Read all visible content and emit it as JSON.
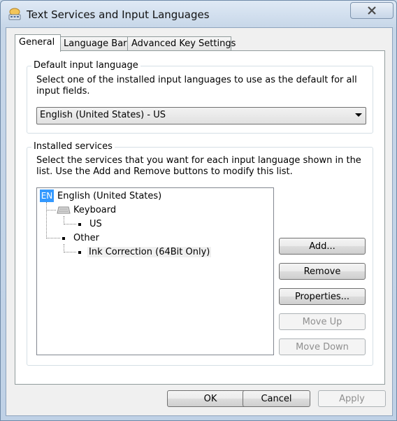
{
  "window": {
    "title": "Text Services and Input Languages",
    "close_icon": "close-icon"
  },
  "tabs": [
    {
      "label": "General",
      "active": true
    },
    {
      "label": "Language Bar",
      "active": false
    },
    {
      "label": "Advanced Key Settings",
      "active": false
    }
  ],
  "default_language": {
    "group_label": "Default input language",
    "description": "Select one of the installed input languages to use as the default for all input fields.",
    "selected": "English (United States) - US"
  },
  "installed_services": {
    "group_label": "Installed services",
    "description": "Select the services that you want for each input language shown in the list. Use the Add and Remove buttons to modify this list.",
    "tree": {
      "language_badge": "EN",
      "language": "English (United States)",
      "keyboard_label": "Keyboard",
      "keyboard_item": "US",
      "other_label": "Other",
      "other_item": "Ink Correction (64Bit Only)"
    },
    "buttons": {
      "add": "Add...",
      "remove": "Remove",
      "properties": "Properties...",
      "move_up": "Move Up",
      "move_down": "Move Down"
    }
  },
  "footer": {
    "ok": "OK",
    "cancel": "Cancel",
    "apply": "Apply"
  },
  "colors": {
    "selection": "#3399ff",
    "window_frame": "#c6d6e8",
    "disabled_text": "#8f8f8f"
  }
}
